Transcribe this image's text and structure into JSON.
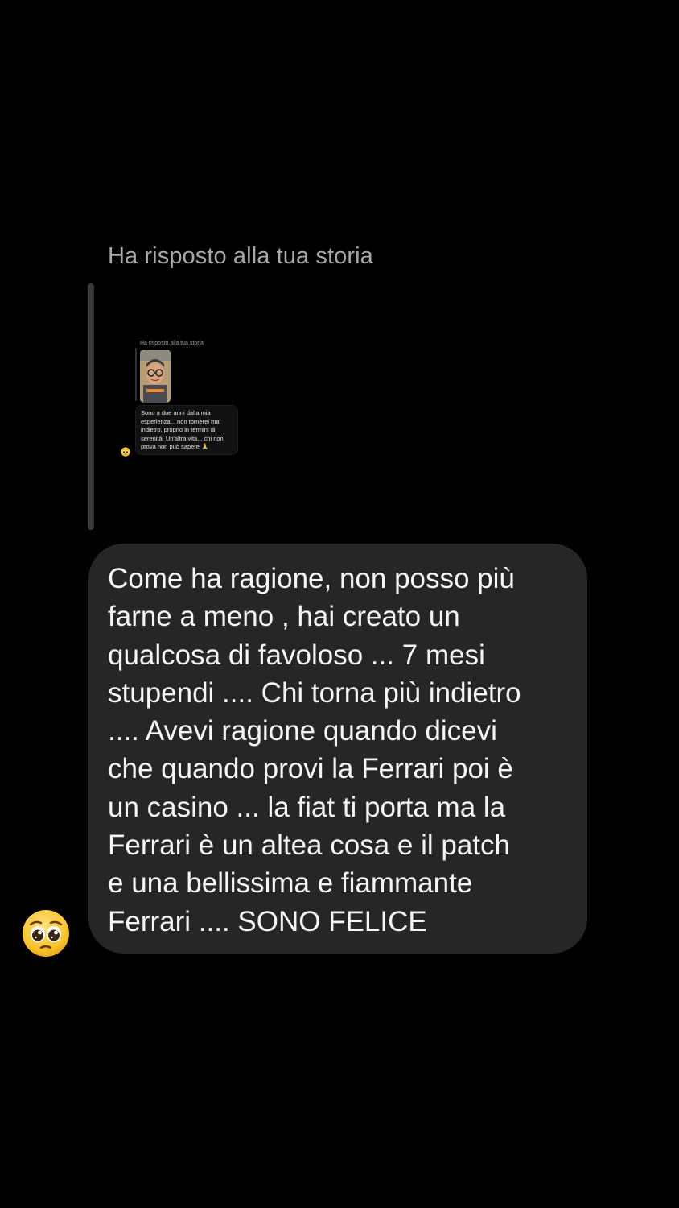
{
  "story_reply": {
    "header_label": "Ha risposto alla tua storia"
  },
  "story_preview": {
    "header_label": "Ha risposto alla tua storia",
    "message_text": "Sono a due anni dalla mia\nesperienza... non tornerei mai\nindietro, proprio in termini di\nserenità! Un'altra vita... chi non\nprova non può sapere 🙏",
    "reaction_icon": "pleading-face-emoji"
  },
  "message": {
    "text": "Come ha ragione, non posso più\nfarne a meno , hai creato un\nqualcosa di favoloso ... 7 mesi\nstupendi .... Chi torna più indietro\n.... Avevi ragione quando dicevi\nche quando provi la Ferrari poi è\nun casino ... la fiat ti porta ma la\nFerrari è un altea cosa e il patch\ne una bellissima e fiammante\nFerrari .... SONO FELICE",
    "reaction_icon": "pleading-face-emoji"
  },
  "colors": {
    "background": "#000000",
    "bubble": "#262626",
    "text": "#f5f5f5",
    "secondary_text": "#a8a8a8",
    "emoji": "#f8c52c"
  }
}
